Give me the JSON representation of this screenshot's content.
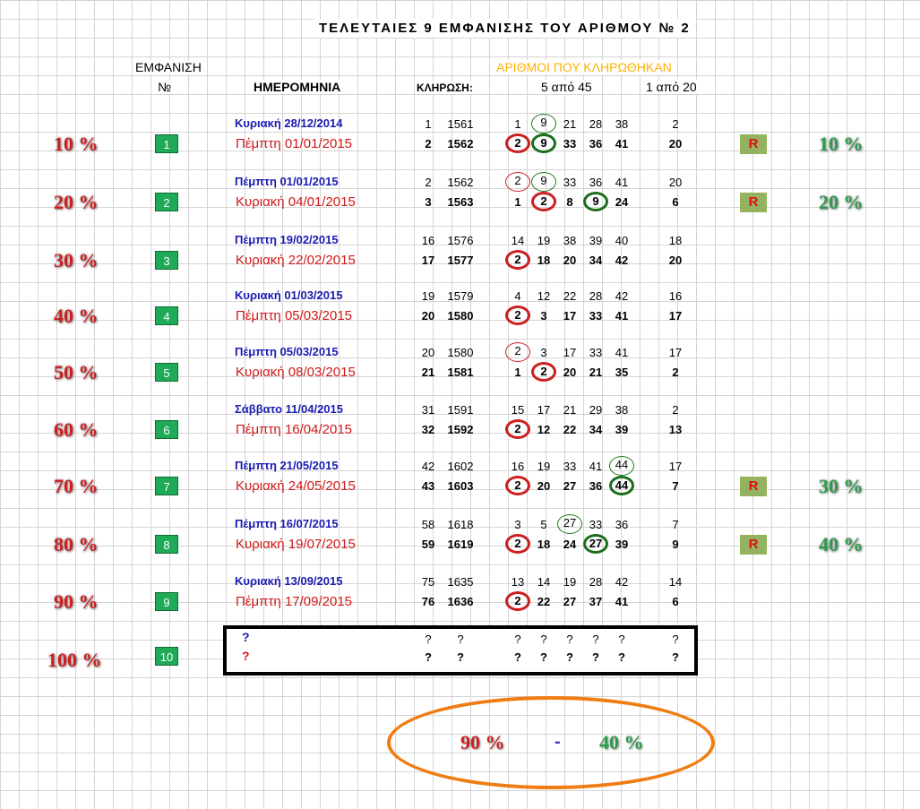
{
  "title": "ΤΕΛΕΥΤΑΙΕΣ  9  ΕΜΦΑΝΙΣΗΣ  ΤΟΥ  ΑΡΙΘΜΟΥ  № 2",
  "headers": {
    "emfanisi": "ΕΜΦΑΝΙΣΗ",
    "no": "№",
    "date": "ΗΜΕΡΟΜΗΝΙΑ",
    "draw": "ΚΛΗΡΩΣΗ:",
    "drawn_numbers": "ΑΡΙΘΜΟΙ ΠΟΥ ΚΛΗΡΩΘΗΚΑΝ",
    "five_of_45": "5 από 45",
    "one_of_20": "1 από 20"
  },
  "rows": [
    {
      "pct": "10 %",
      "badge": "1",
      "top": {
        "date": "Κυριακή 28/12/2014",
        "idx": "1",
        "draw": "1561",
        "nums": [
          "1",
          "9",
          "21",
          "28",
          "38"
        ],
        "bonus": "2"
      },
      "bot": {
        "date": "Πέμπτη 01/01/2015",
        "idx": "2",
        "draw": "1562",
        "nums": [
          "2",
          "9",
          "33",
          "36",
          "41"
        ],
        "bonus": "20"
      },
      "r": "R",
      "right_pct": "10 %"
    },
    {
      "pct": "20 %",
      "badge": "2",
      "top": {
        "date": "Πέμπτη 01/01/2015",
        "idx": "2",
        "draw": "1562",
        "nums": [
          "2",
          "9",
          "33",
          "36",
          "41"
        ],
        "bonus": "20"
      },
      "bot": {
        "date": "Κυριακή 04/01/2015",
        "idx": "3",
        "draw": "1563",
        "nums": [
          "1",
          "2",
          "8",
          "9",
          "24"
        ],
        "bonus": "6"
      },
      "r": "R",
      "right_pct": "20 %"
    },
    {
      "pct": "30 %",
      "badge": "3",
      "top": {
        "date": "Πέμπτη 19/02/2015",
        "idx": "16",
        "draw": "1576",
        "nums": [
          "14",
          "19",
          "38",
          "39",
          "40"
        ],
        "bonus": "18"
      },
      "bot": {
        "date": "Κυριακή 22/02/2015",
        "idx": "17",
        "draw": "1577",
        "nums": [
          "2",
          "18",
          "20",
          "34",
          "42"
        ],
        "bonus": "20"
      }
    },
    {
      "pct": "40 %",
      "badge": "4",
      "top": {
        "date": "Κυριακή 01/03/2015",
        "idx": "19",
        "draw": "1579",
        "nums": [
          "4",
          "12",
          "22",
          "28",
          "42"
        ],
        "bonus": "16"
      },
      "bot": {
        "date": "Πέμπτη 05/03/2015",
        "idx": "20",
        "draw": "1580",
        "nums": [
          "2",
          "3",
          "17",
          "33",
          "41"
        ],
        "bonus": "17"
      }
    },
    {
      "pct": "50 %",
      "badge": "5",
      "top": {
        "date": "Πέμπτη 05/03/2015",
        "idx": "20",
        "draw": "1580",
        "nums": [
          "2",
          "3",
          "17",
          "33",
          "41"
        ],
        "bonus": "17"
      },
      "bot": {
        "date": "Κυριακή 08/03/2015",
        "idx": "21",
        "draw": "1581",
        "nums": [
          "1",
          "2",
          "20",
          "21",
          "35"
        ],
        "bonus": "2"
      }
    },
    {
      "pct": "60 %",
      "badge": "6",
      "top": {
        "date": "Σάββατο 11/04/2015",
        "idx": "31",
        "draw": "1591",
        "nums": [
          "15",
          "17",
          "21",
          "29",
          "38"
        ],
        "bonus": "2"
      },
      "bot": {
        "date": "Πέμπτη 16/04/2015",
        "idx": "32",
        "draw": "1592",
        "nums": [
          "2",
          "12",
          "22",
          "34",
          "39"
        ],
        "bonus": "13"
      }
    },
    {
      "pct": "70 %",
      "badge": "7",
      "top": {
        "date": "Πέμπτη 21/05/2015",
        "idx": "42",
        "draw": "1602",
        "nums": [
          "16",
          "19",
          "33",
          "41",
          "44"
        ],
        "bonus": "17"
      },
      "bot": {
        "date": "Κυριακή 24/05/2015",
        "idx": "43",
        "draw": "1603",
        "nums": [
          "2",
          "20",
          "27",
          "36",
          "44"
        ],
        "bonus": "7"
      },
      "r": "R",
      "right_pct": "30 %"
    },
    {
      "pct": "80 %",
      "badge": "8",
      "top": {
        "date": "Πέμπτη 16/07/2015",
        "idx": "58",
        "draw": "1618",
        "nums": [
          "3",
          "5",
          "27",
          "33",
          "36"
        ],
        "bonus": "7"
      },
      "bot": {
        "date": "Κυριακή 19/07/2015",
        "idx": "59",
        "draw": "1619",
        "nums": [
          "2",
          "18",
          "24",
          "27",
          "39"
        ],
        "bonus": "9"
      },
      "r": "R",
      "right_pct": "40 %"
    },
    {
      "pct": "90 %",
      "badge": "9",
      "top": {
        "date": "Κυριακή 13/09/2015",
        "idx": "75",
        "draw": "1635",
        "nums": [
          "13",
          "14",
          "19",
          "28",
          "42"
        ],
        "bonus": "14"
      },
      "bot": {
        "date": "Πέμπτη 17/09/2015",
        "idx": "76",
        "draw": "1636",
        "nums": [
          "2",
          "22",
          "27",
          "37",
          "41"
        ],
        "bonus": "6"
      }
    }
  ],
  "future": {
    "pct": "100 %",
    "badge": "10",
    "mark": "?"
  },
  "summary": {
    "left": "90 %",
    "dash": "-",
    "right": "40 %"
  },
  "colors": {
    "red": "#cc1f1f",
    "green": "#2e9b4c",
    "orange": "#f07d14",
    "badge": "#1faa58"
  }
}
